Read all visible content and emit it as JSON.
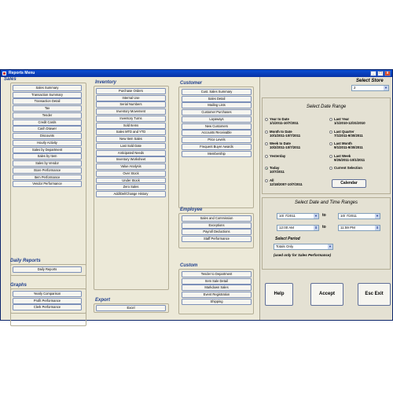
{
  "window": {
    "title": "Reports Menu",
    "min": "_",
    "max": "□",
    "close": "x"
  },
  "sales": {
    "caption": "Sales",
    "items": [
      "Sales Summary",
      "Transaction Summary",
      "Transaction Detail",
      "Tax",
      "Tender",
      "Credit Cards",
      "Cash Drawer",
      "Discounts",
      "Hourly Activity",
      "Sales by Department",
      "Sales by Item",
      "Sales by Vendor",
      "Store Performance",
      "Item Performance",
      "Vendor Performance"
    ]
  },
  "daily": {
    "caption": "Daily Reports",
    "items": [
      "Daily Reports"
    ]
  },
  "graphs": {
    "caption": "Graphs",
    "items": [
      "Yearly Comparison",
      "Profit Performance",
      "Clerk Performance"
    ]
  },
  "inventory": {
    "caption": "Inventory",
    "items": [
      "Purchase Orders",
      "Internal Use",
      "Serial Numbers",
      "Inventory Movement",
      "Inventory Turns",
      "Sold Items",
      "Sales MTD and YTD",
      "New Item Sales",
      "Last Sold Date",
      "Anticipated Needs",
      "Inventory Worksheet",
      "Value Analysis",
      "Over Stock",
      "Under Stock",
      "Zero Sales",
      "Add/Del/Change History"
    ]
  },
  "export": {
    "caption": "Export",
    "items": [
      "Excel"
    ]
  },
  "customer": {
    "caption": "Customer",
    "items": [
      "Cust. Sales Summary",
      "Sales Detail",
      "Mailing Lists",
      "Customer Purchases",
      "Layaways",
      "New Customers",
      "Accounts Receivable",
      "Price Levels",
      "Frequent Buyer Awards",
      "Membership"
    ]
  },
  "employee": {
    "caption": "Employee",
    "items": [
      "Sales and Commission",
      "Exceptions",
      "Payroll Deductions",
      "Staff Performance"
    ]
  },
  "custom": {
    "caption": "Custom",
    "items": [
      "Tender to Department",
      "Item Sale Detail",
      "Markdown Sales",
      "Event Registration",
      "Shipping"
    ]
  },
  "store": {
    "label": "Select Store",
    "value": "2"
  },
  "daterange": {
    "title": "Select Date Range",
    "left": [
      {
        "label": "Year to Date",
        "range": "1/1/2011-10/7/2011"
      },
      {
        "label": "Month to Date",
        "range": "10/1/2011-10/7/2011"
      },
      {
        "label": "Week to Date",
        "range": "10/2/2011-10/7/2011"
      },
      {
        "label": "Yesterday",
        "range": ""
      },
      {
        "label": "Today",
        "range": "10/7/2011"
      },
      {
        "label": "All",
        "range": "12/18/2007-10/7/2011"
      }
    ],
    "right": [
      {
        "label": "Last Year",
        "range": "1/1/2010-12/31/2010"
      },
      {
        "label": "Last Quarter",
        "range": "7/1/2011-9/30/2011"
      },
      {
        "label": "Last Month",
        "range": "9/1/2011-9/30/2011"
      },
      {
        "label": "Last Week",
        "range": "9/25/2011-10/1/2011"
      },
      {
        "label": "Current Selection",
        "range": ""
      }
    ],
    "calendar": "Calendar"
  },
  "datetime": {
    "title": "Select Date and Time Ranges",
    "start_date": "10/ 7/2011",
    "end_date": "10/ 7/2011",
    "start_time": "12:00 AM",
    "end_time": "11:59 PM",
    "to1": "to",
    "to2": "to",
    "period_label": "Select Period",
    "period_value": "Totals Only",
    "note": "(used only for Sales Performance)"
  },
  "buttons": {
    "help": "Help",
    "accept": "Accept",
    "exit": "Esc Exit"
  }
}
